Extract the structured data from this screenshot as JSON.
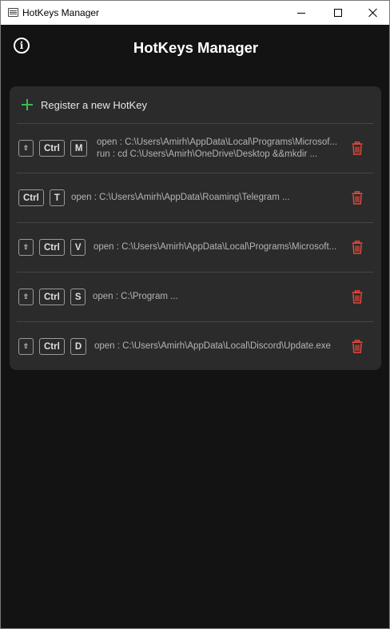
{
  "window": {
    "title": "HotKeys Manager"
  },
  "header": {
    "title": "HotKeys Manager"
  },
  "register": {
    "label": "Register a new HotKey"
  },
  "colors": {
    "accent_green": "#3fb950",
    "delete_red": "#e5473b",
    "background": "#131313",
    "card": "#2b2b2b"
  },
  "hotkeys": [
    {
      "keys": [
        "⇧",
        "Ctrl",
        "M"
      ],
      "lines": [
        "open : C:\\Users\\Amirh\\AppData\\Local\\Programs\\Microsof...",
        "run : cd C:\\Users\\Amirh\\OneDrive\\Desktop &&mkdir ..."
      ]
    },
    {
      "keys": [
        "Ctrl",
        "T"
      ],
      "lines": [
        "open : C:\\Users\\Amirh\\AppData\\Roaming\\Telegram ..."
      ]
    },
    {
      "keys": [
        "⇧",
        "Ctrl",
        "V"
      ],
      "lines": [
        "open : C:\\Users\\Amirh\\AppData\\Local\\Programs\\Microsoft..."
      ]
    },
    {
      "keys": [
        "⇧",
        "Ctrl",
        "S"
      ],
      "lines": [
        "open : C:\\Program ..."
      ]
    },
    {
      "keys": [
        "⇧",
        "Ctrl",
        "D"
      ],
      "lines": [
        "open : C:\\Users\\Amirh\\AppData\\Local\\Discord\\Update.exe"
      ]
    }
  ],
  "icons": {
    "info": "info-icon",
    "add": "plus-icon",
    "delete": "trash-icon",
    "shift": "shift-arrow-icon"
  }
}
